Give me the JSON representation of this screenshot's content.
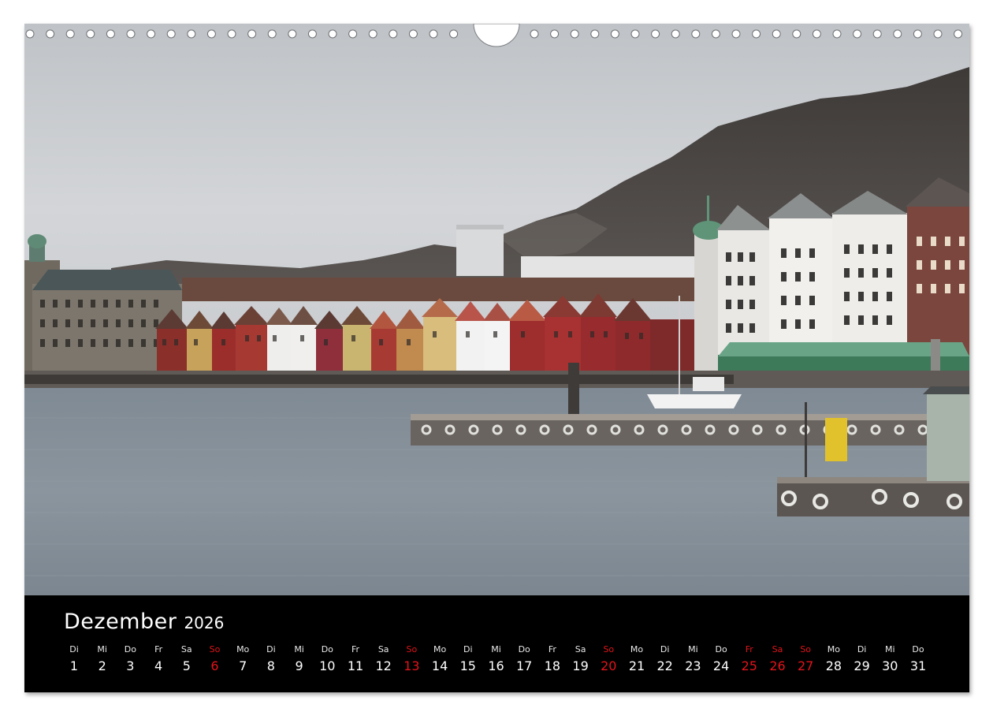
{
  "calendar": {
    "month": "Dezember",
    "year": "2026",
    "days": [
      {
        "dow": "Di",
        "num": "1",
        "holiday": false
      },
      {
        "dow": "Mi",
        "num": "2",
        "holiday": false
      },
      {
        "dow": "Do",
        "num": "3",
        "holiday": false
      },
      {
        "dow": "Fr",
        "num": "4",
        "holiday": false
      },
      {
        "dow": "Sa",
        "num": "5",
        "holiday": false
      },
      {
        "dow": "So",
        "num": "6",
        "holiday": true
      },
      {
        "dow": "Mo",
        "num": "7",
        "holiday": false
      },
      {
        "dow": "Di",
        "num": "8",
        "holiday": false
      },
      {
        "dow": "Mi",
        "num": "9",
        "holiday": false
      },
      {
        "dow": "Do",
        "num": "10",
        "holiday": false
      },
      {
        "dow": "Fr",
        "num": "11",
        "holiday": false
      },
      {
        "dow": "Sa",
        "num": "12",
        "holiday": false
      },
      {
        "dow": "So",
        "num": "13",
        "holiday": true
      },
      {
        "dow": "Mo",
        "num": "14",
        "holiday": false
      },
      {
        "dow": "Di",
        "num": "15",
        "holiday": false
      },
      {
        "dow": "Mi",
        "num": "16",
        "holiday": false
      },
      {
        "dow": "Do",
        "num": "17",
        "holiday": false
      },
      {
        "dow": "Fr",
        "num": "18",
        "holiday": false
      },
      {
        "dow": "Sa",
        "num": "19",
        "holiday": false
      },
      {
        "dow": "So",
        "num": "20",
        "holiday": true
      },
      {
        "dow": "Mo",
        "num": "21",
        "holiday": false
      },
      {
        "dow": "Di",
        "num": "22",
        "holiday": false
      },
      {
        "dow": "Mi",
        "num": "23",
        "holiday": false
      },
      {
        "dow": "Do",
        "num": "24",
        "holiday": false
      },
      {
        "dow": "Fr",
        "num": "25",
        "holiday": true
      },
      {
        "dow": "Sa",
        "num": "26",
        "holiday": true
      },
      {
        "dow": "So",
        "num": "27",
        "holiday": true
      },
      {
        "dow": "Mo",
        "num": "28",
        "holiday": false
      },
      {
        "dow": "Di",
        "num": "29",
        "holiday": false
      },
      {
        "dow": "Mi",
        "num": "30",
        "holiday": false
      },
      {
        "dow": "Do",
        "num": "31",
        "holiday": false
      }
    ]
  },
  "colors": {
    "holiday": "#e2141b",
    "text": "#ffffff",
    "band": "#000000"
  }
}
